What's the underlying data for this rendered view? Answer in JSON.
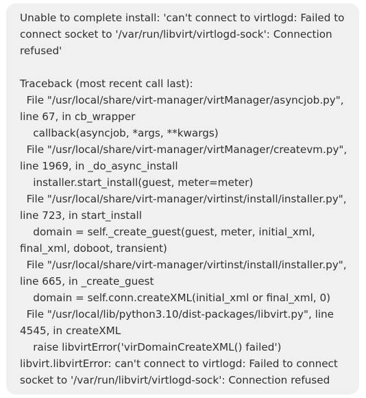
{
  "error_dialog": {
    "lines": [
      "Unable to complete install: 'can't connect to virtlogd: Failed to",
      "connect socket to '/var/run/libvirt/virtlogd-sock': Connection",
      "refused'",
      "",
      "Traceback (most recent call last):",
      "  File \"/usr/local/share/virt-manager/virtManager/asyncjob.py\",",
      "line 67, in cb_wrapper",
      "    callback(asyncjob, *args, **kwargs)",
      "  File \"/usr/local/share/virt-manager/virtManager/createvm.py\",",
      "line 1969, in _do_async_install",
      "    installer.start_install(guest, meter=meter)",
      "  File \"/usr/local/share/virt-manager/virtinst/install/installer.py\",",
      "line 723, in start_install",
      "    domain = self._create_guest(guest, meter, initial_xml,",
      "final_xml, doboot, transient)",
      "  File \"/usr/local/share/virt-manager/virtinst/install/installer.py\",",
      "line 665, in _create_guest",
      "    domain = self.conn.createXML(initial_xml or final_xml, 0)",
      "  File \"/usr/local/lib/python3.10/dist-packages/libvirt.py\", line",
      "4545, in createXML",
      "    raise libvirtError('virDomainCreateXML() failed')",
      "libvirt.libvirtError: can't connect to virtlogd: Failed to connect",
      "socket to '/var/run/libvirt/virtlogd-sock': Connection refused"
    ]
  }
}
